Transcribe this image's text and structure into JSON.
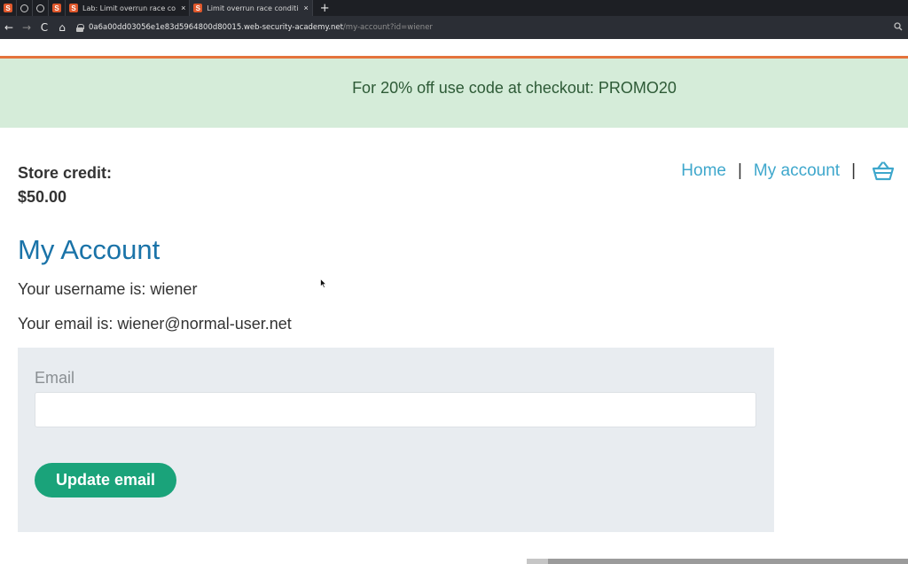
{
  "browser": {
    "tabs": [
      {
        "icon": "portswigger-favicon",
        "title": ""
      },
      {
        "icon": "globe-icon",
        "title": ""
      },
      {
        "icon": "globe-icon",
        "title": ""
      },
      {
        "icon": "portswigger-favicon",
        "title": ""
      },
      {
        "icon": "portswigger-favicon",
        "title": "Lab: Limit overrun race co",
        "close": "×"
      },
      {
        "icon": "portswigger-favicon",
        "title": "Limit overrun race conditi",
        "close": "×",
        "active": true
      }
    ],
    "new_tab": "+",
    "nav": {
      "back": "←",
      "forward": "→",
      "reload": "C",
      "home": "⌂"
    },
    "url_host": "0a6a00dd03056e1e83d5964800d80015.web-security-academy.net",
    "url_path": "/my-account?id=wiener"
  },
  "promo": {
    "text": "For 20% off use code at checkout: PROMO20",
    "background": "#d5ecd9",
    "accent": "#e4733c"
  },
  "store_credit": {
    "label": "Store credit:",
    "amount": "$50.00"
  },
  "header_nav": {
    "home": "Home",
    "separator": "|",
    "my_account": "My account",
    "cart_icon": "basket-icon",
    "link_color": "#3ea7cc"
  },
  "account": {
    "title": "My Account",
    "username_line": "Your username is: wiener",
    "email_line": "Your email is: wiener@normal-user.net"
  },
  "email_form": {
    "label": "Email",
    "value": "",
    "placeholder": "",
    "submit_label": "Update email",
    "button_color": "#1aa37a"
  }
}
